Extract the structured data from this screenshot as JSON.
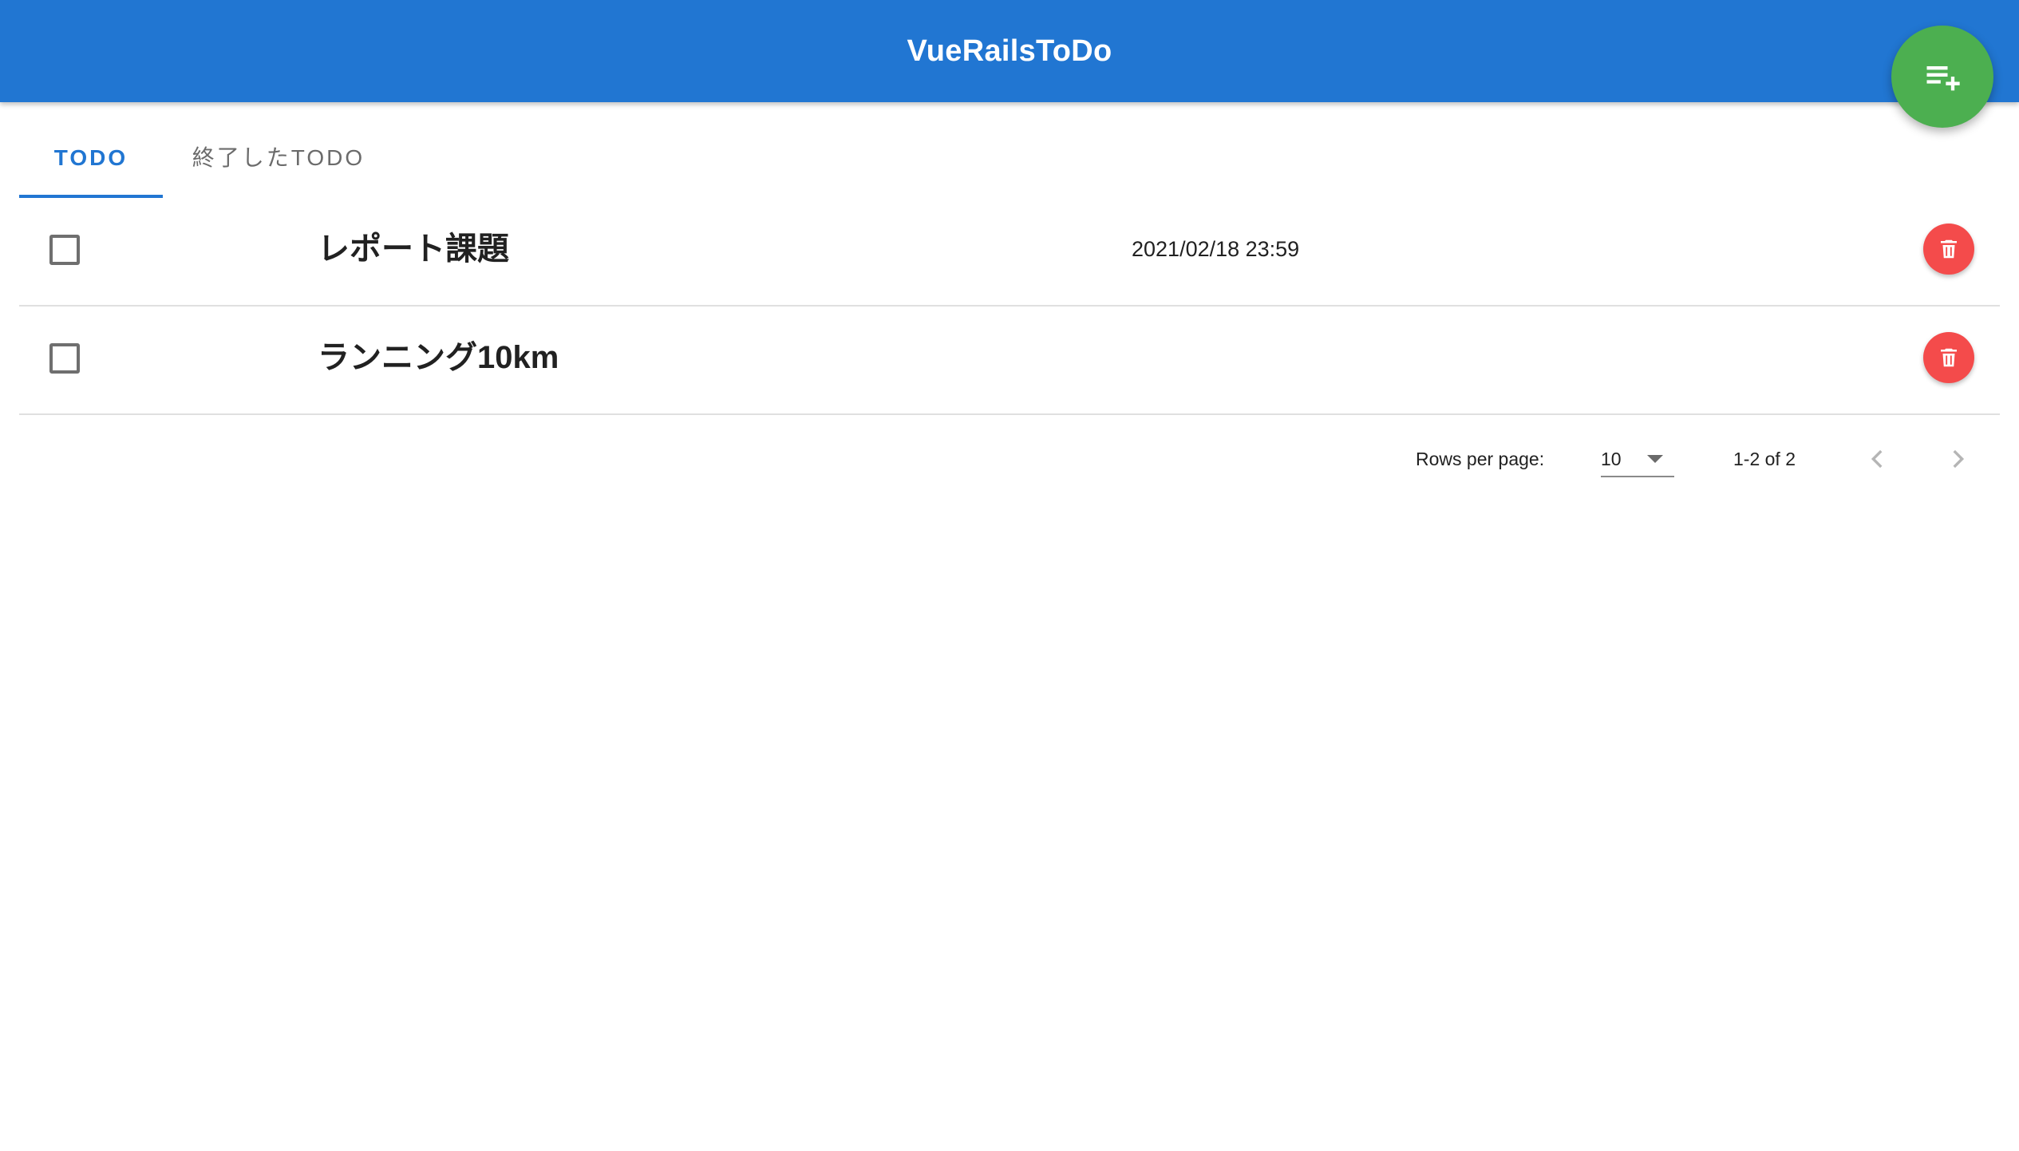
{
  "app": {
    "title": "VueRailsToDo"
  },
  "fab": {
    "icon": "playlist-add-icon",
    "color": "#4caf50"
  },
  "tabs": [
    {
      "label": "TODO",
      "active": true
    },
    {
      "label": "終了したTODO",
      "active": false
    }
  ],
  "todos": [
    {
      "title": "レポート課題",
      "due": "2021/02/18 23:59",
      "done": false
    },
    {
      "title": "ランニング10km",
      "due": "",
      "done": false
    }
  ],
  "pagination": {
    "rows_per_page_label": "Rows per page:",
    "rows_per_page_value": "10",
    "range_text": "1-2 of 2"
  },
  "colors": {
    "primary": "#2176d2",
    "delete": "#f44b4b",
    "fab": "#4caf50"
  }
}
